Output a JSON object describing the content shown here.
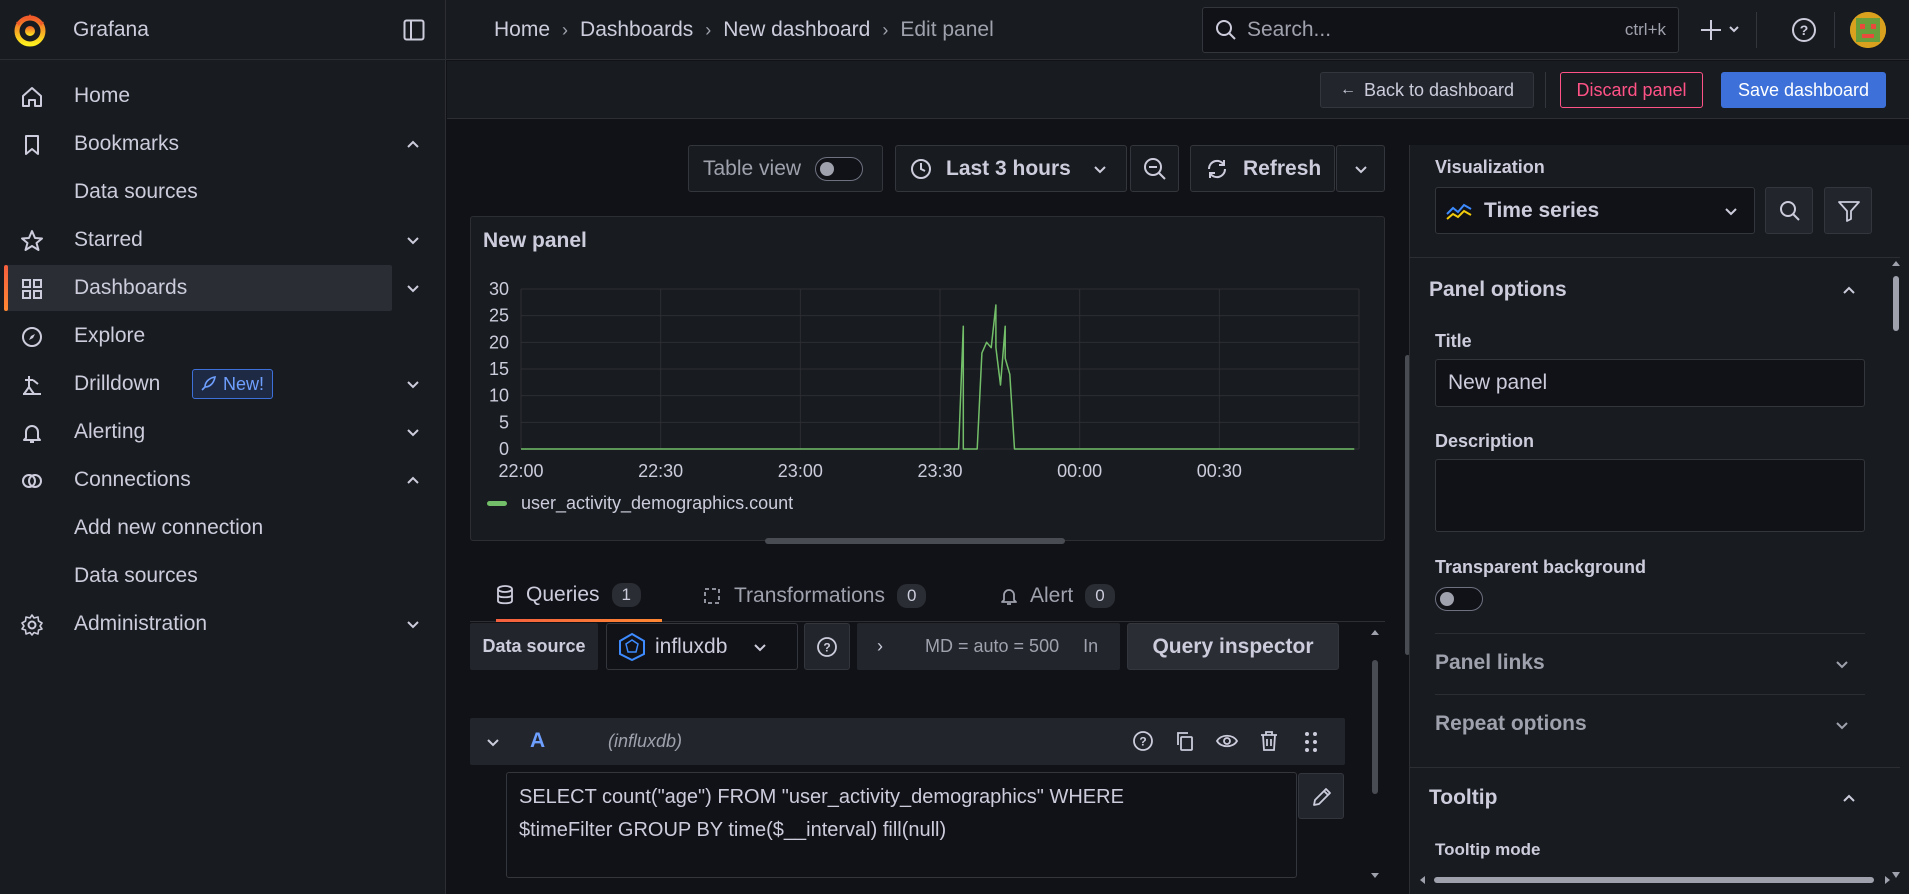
{
  "app": {
    "name": "Grafana"
  },
  "breadcrumbs": [
    "Home",
    "Dashboards",
    "New dashboard",
    "Edit panel"
  ],
  "search": {
    "placeholder": "Search...",
    "shortcut": "ctrl+k"
  },
  "sidebar": {
    "items": [
      {
        "label": "Home",
        "icon": "home-icon"
      },
      {
        "label": "Bookmarks",
        "icon": "bookmark-icon",
        "expanded": true
      },
      {
        "label": "Data sources",
        "sub": true
      },
      {
        "label": "Starred",
        "icon": "star-icon"
      },
      {
        "label": "Dashboards",
        "icon": "apps-icon",
        "active": true
      },
      {
        "label": "Explore",
        "icon": "compass-icon"
      },
      {
        "label": "Drilldown",
        "icon": "drilldown-icon",
        "badge": "New!"
      },
      {
        "label": "Alerting",
        "icon": "bell-icon"
      },
      {
        "label": "Connections",
        "icon": "connections-icon",
        "expanded": true
      },
      {
        "label": "Add new connection",
        "sub": true
      },
      {
        "label": "Data sources",
        "sub": true
      },
      {
        "label": "Administration",
        "icon": "cog-icon"
      }
    ]
  },
  "actions": {
    "back": "Back to dashboard",
    "discard": "Discard panel",
    "save": "Save dashboard"
  },
  "panel_controls": {
    "table_view": "Table view",
    "time_range": "Last 3 hours",
    "refresh": "Refresh"
  },
  "panel": {
    "title": "New panel",
    "legend": "user_activity_demographics.count"
  },
  "chart_data": {
    "type": "line",
    "title": "New panel",
    "x_ticks": [
      "22:00",
      "22:30",
      "23:00",
      "23:30",
      "00:00",
      "00:30"
    ],
    "y_ticks": [
      0,
      5,
      10,
      15,
      20,
      25,
      30
    ],
    "ylim": [
      0,
      30
    ],
    "xlim_minutes_from_2200": [
      0,
      180
    ],
    "grid": true,
    "legend_position": "bottom-left",
    "series": [
      {
        "name": "user_activity_demographics.count",
        "color": "#73bf69",
        "x": [
          "22:00",
          "23:34",
          "23:35",
          "23:35",
          "23:36",
          "23:36",
          "23:38",
          "23:39",
          "23:40",
          "23:41",
          "23:42",
          "23:42",
          "23:43",
          "23:44",
          "23:44",
          "23:45",
          "23:46",
          "23:47",
          "23:47",
          "23:48",
          "23:49",
          "00:59"
        ],
        "y": [
          0,
          0,
          23,
          0,
          0,
          0,
          0,
          18,
          20,
          19,
          27,
          19,
          12,
          23,
          17,
          14,
          0,
          0,
          0,
          0,
          0,
          0
        ]
      }
    ]
  },
  "query_tabs": [
    {
      "label": "Queries",
      "count": "1"
    },
    {
      "label": "Transformations",
      "count": "0"
    },
    {
      "label": "Alert",
      "count": "0"
    }
  ],
  "query_toolbar": {
    "data_source_label": "Data source",
    "data_source": "influxdb",
    "options_summary": "MD = auto = 500",
    "options_trailing": "In",
    "inspector": "Query inspector"
  },
  "query": {
    "ref": "A",
    "source": "(influxdb)",
    "text_line1": "SELECT count(\"age\") FROM \"user_activity_demographics\" WHERE",
    "text_line2": "$timeFilter GROUP BY time($__interval) fill(null)"
  },
  "options": {
    "visualization_label": "Visualization",
    "visualization": "Time series",
    "panel_options": "Panel options",
    "title_label": "Title",
    "title_value": "New panel",
    "description_label": "Description",
    "transparent_label": "Transparent background",
    "panel_links": "Panel links",
    "repeat_options": "Repeat options",
    "tooltip": "Tooltip",
    "tooltip_mode": "Tooltip mode"
  },
  "colors": {
    "accent": "#3d71d9",
    "danger": "#ff5286",
    "series": "#73bf69",
    "brand": "#f55f3e"
  }
}
